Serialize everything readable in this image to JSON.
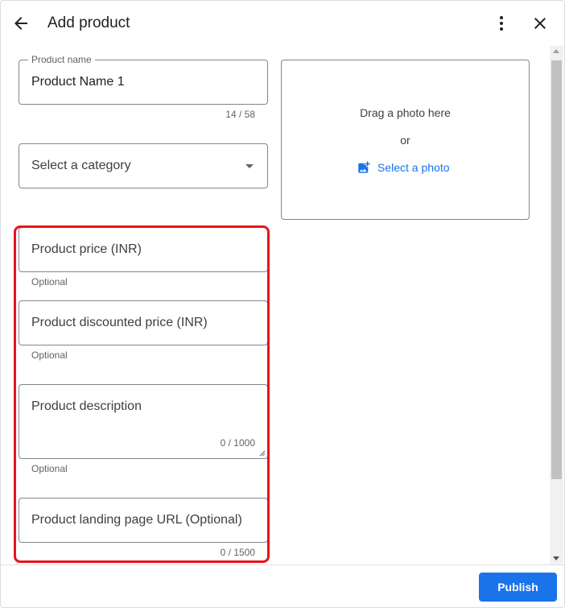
{
  "header": {
    "title": "Add product",
    "back_icon": "arrow-back-icon",
    "more_icon": "more-vert-icon",
    "close_icon": "close-icon"
  },
  "form": {
    "product_name": {
      "label": "Product name",
      "value": "Product Name 1",
      "counter": "14 / 58"
    },
    "category": {
      "placeholder": "Select a category"
    },
    "price": {
      "placeholder": "Product price (INR)",
      "helper": "Optional"
    },
    "discounted_price": {
      "placeholder": "Product discounted price (INR)",
      "helper": "Optional"
    },
    "description": {
      "placeholder": "Product description",
      "counter": "0 / 1000",
      "helper": "Optional"
    },
    "landing_url": {
      "placeholder": "Product landing page URL (Optional)",
      "counter": "0 / 1500"
    }
  },
  "photo": {
    "drag_text": "Drag a photo here",
    "or_text": "or",
    "select_label": "Select a photo",
    "icon": "add-photo-icon"
  },
  "footer": {
    "publish_label": "Publish"
  },
  "colors": {
    "accent": "#1a73e8",
    "highlight": "#e8141b"
  }
}
